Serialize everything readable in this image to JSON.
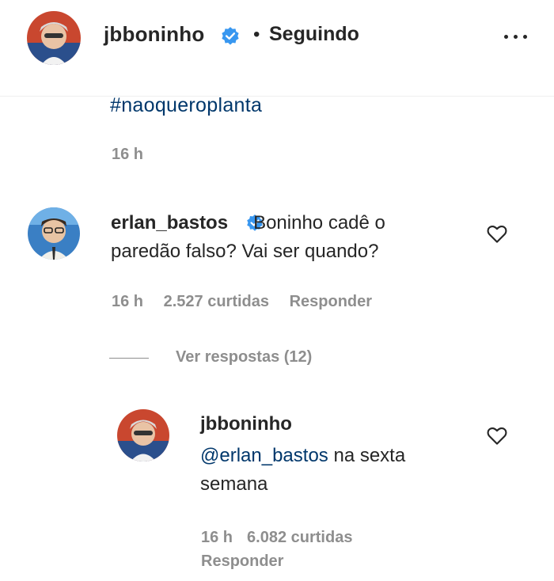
{
  "post_header": {
    "username": "jbboninho",
    "separator": "•",
    "follow_status": "Seguindo"
  },
  "caption": {
    "hashtag": "#naoqueroplanta",
    "time": "16 h"
  },
  "comment": {
    "username": "erlan_bastos",
    "text": "Boninho cadê o paredão falso? Vai ser quando?",
    "time": "16 h",
    "likes": "2.527 curtidas",
    "reply_label": "Responder"
  },
  "view_replies": {
    "label": "Ver respostas (12)"
  },
  "reply": {
    "username": "jbboninho",
    "mention": "@erlan_bastos",
    "text": " na sexta semana",
    "time": "16 h",
    "likes": "6.082 curtidas",
    "reply_label": "Responder"
  },
  "colors": {
    "verified_blue": "#3897f0",
    "link_blue": "#00376b",
    "muted_gray": "#8e8e8e"
  },
  "icons": [
    "verified-badge-icon",
    "more-options-icon",
    "heart-icon"
  ]
}
